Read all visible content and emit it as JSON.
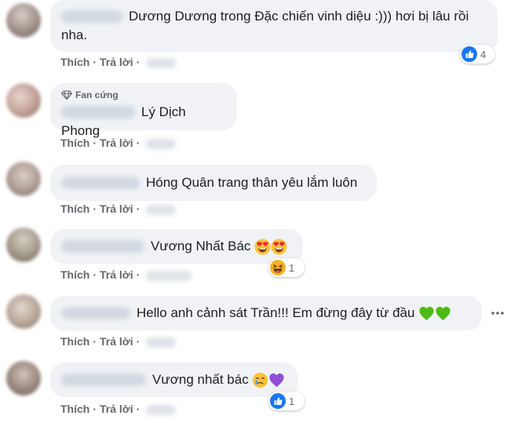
{
  "actions": {
    "like": "Thích",
    "reply": "Trả lời",
    "separator": "·"
  },
  "icons": {
    "like_reaction": "thumbs-up-icon",
    "haha_reaction": "laughing-face-icon",
    "heart_eyes": "heart-eyes-emoji",
    "green_heart": "green-heart-emoji",
    "purple_heart": "purple-heart-emoji",
    "crying_face": "crying-face-emoji",
    "diamond": "diamond-icon",
    "more": "more-options-icon"
  },
  "colors": {
    "like_blue": "#1877f2",
    "bubble": "#f0f2f5",
    "meta_text": "#65676b"
  },
  "comments": [
    {
      "text_line1": "Dương Dương trong Đặc chiến vinh diệu :))) hơi bị lâu rồi",
      "text_line2": "nha.",
      "reaction_count": "4"
    },
    {
      "badge": "Fan cứng",
      "text": "Lý Dịch Phong"
    },
    {
      "text": "Hóng Quân trang thân yêu lắm luôn"
    },
    {
      "text": "Vương Nhất Bác",
      "reaction_count": "1"
    },
    {
      "text": "Hello anh cảnh sát Trần!!! Em đừng đây từ đầu"
    },
    {
      "text": "Vương nhất bác",
      "reaction_count": "1"
    }
  ]
}
